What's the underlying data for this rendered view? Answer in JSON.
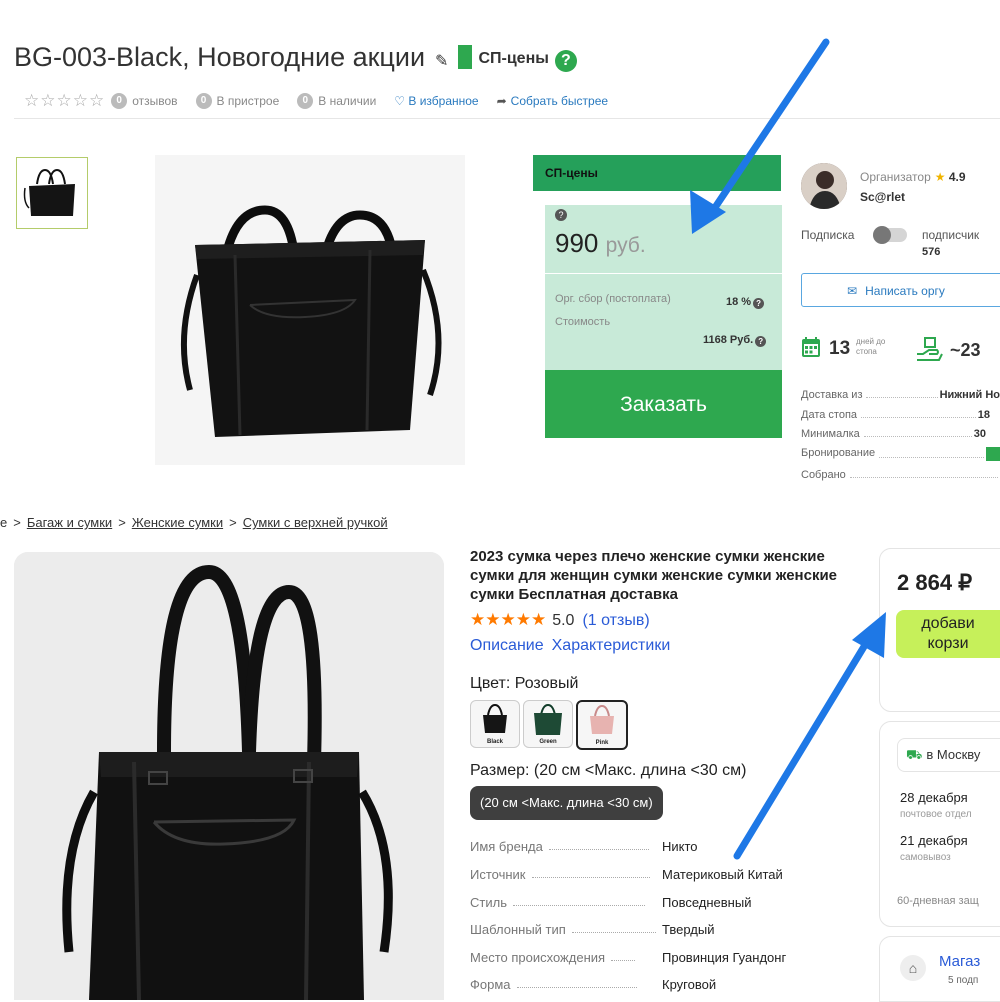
{
  "listing": {
    "title": "BG-003-Black, Новогодние акции",
    "badge_label": "СП-цены",
    "help_symbol": "?",
    "stars": "☆☆☆☆☆",
    "reviews_count": "0",
    "reviews_label": "отзывов",
    "attached_count": "0",
    "attached_label": "В пристрое",
    "stock_count": "0",
    "stock_label": "В наличии",
    "favorite_label": "♡ В избранное",
    "quick_label": "Собрать быстрее"
  },
  "price_card": {
    "header": "СП-цены",
    "price": "990",
    "currency": "руб.",
    "fee_label": "Орг. сбор (постоплата)",
    "fee_value": "18 %",
    "cost_label": "Стоимость",
    "cost_value": "1168 Руб.",
    "order_label": "Заказать"
  },
  "organizer": {
    "label": "Организатор",
    "rating": "4.9",
    "name": "Sc@rlet",
    "subscribe_label": "Подписка",
    "subscribers_label": "подписчик",
    "subscribers_count": "576",
    "write_label": "Написать оргу",
    "days_number": "13",
    "days_label_1": "дней до",
    "days_label_2": "стопа",
    "approx_number": "~23",
    "rows": [
      {
        "label": "Доставка из",
        "value": "Нижний Но"
      },
      {
        "label": "Дата стопа",
        "value": "18"
      },
      {
        "label": "Минималка",
        "value": "30"
      },
      {
        "label": "Бронирование",
        "value": ""
      },
      {
        "label": "Собрано",
        "value": ""
      }
    ]
  },
  "breadcrumb": {
    "first": "е",
    "items": [
      "Багаж и сумки",
      "Женские сумки",
      "Сумки с верхней ручкой"
    ]
  },
  "product": {
    "title": "2023 сумка через плечо женские сумки женские сумки для женщин сумки женские сумки женские сумки Бесплатная доставка",
    "stars": "★★★★★",
    "rating": "5.0",
    "reviews": "(1 отзыв)",
    "tab_description": "Описание",
    "tab_specs": "Характеристики",
    "color_label": "Цвет: Розовый",
    "swatches": [
      "Black",
      "Green",
      "Pink"
    ],
    "size_label": "Размер: (20 см <Макс. длина <30 см)",
    "size_selected": "(20 см <Макс. длина <30 см)",
    "specs": [
      {
        "key": "Имя бренда",
        "value": "Никто"
      },
      {
        "key": "Источник",
        "value": "Материковый Китай"
      },
      {
        "key": "Стиль",
        "value": "Повседневный"
      },
      {
        "key": "Шаблонный тип",
        "value": "Твердый"
      },
      {
        "key": "Место происхождения",
        "value": "Провинция Гуандонг"
      },
      {
        "key": "Форма",
        "value": "Круговой"
      }
    ]
  },
  "buy_panel": {
    "price": "2 864 ₽",
    "cart_label_1": "добави",
    "cart_label_2": "корзи",
    "delivery_city": "в Москву",
    "option1_date": "28 декабря",
    "option1_sub": "почтовое отдел",
    "option2_date": "21 декабря",
    "option2_sub": "самовывоз",
    "guarantee": "60-дневная защ",
    "shop_name": "Магаз",
    "shop_sub": "5 подп"
  },
  "colors": {
    "accent_green": "#2ea84f",
    "price_bg": "#c8ead8",
    "cart_button": "#c6f05a",
    "link_blue": "#2a5bd7",
    "arrow_blue": "#1e78e6"
  }
}
